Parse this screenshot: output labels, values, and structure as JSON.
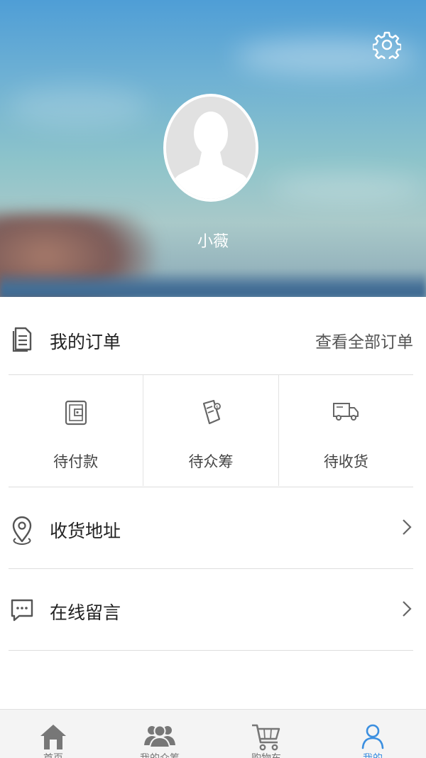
{
  "profile": {
    "username": "小薇"
  },
  "orders": {
    "title": "我的订单",
    "view_all": "查看全部订单",
    "statuses": [
      {
        "label": "待付款",
        "icon": "wallet-icon"
      },
      {
        "label": "待众筹",
        "icon": "crowdfund-icon"
      },
      {
        "label": "待收货",
        "icon": "truck-icon"
      }
    ]
  },
  "menu": [
    {
      "label": "收货地址",
      "icon": "location-pin-icon"
    },
    {
      "label": "在线留言",
      "icon": "message-icon"
    }
  ],
  "tabbar": {
    "active_index": 3,
    "tabs": [
      {
        "label": "首页",
        "icon": "home-icon"
      },
      {
        "label": "我的众筹",
        "icon": "group-icon"
      },
      {
        "label": "购物车",
        "icon": "cart-icon"
      },
      {
        "label": "我的",
        "icon": "person-icon"
      }
    ]
  },
  "colors": {
    "accent": "#3b8fe0",
    "icon_gray": "#777777"
  }
}
